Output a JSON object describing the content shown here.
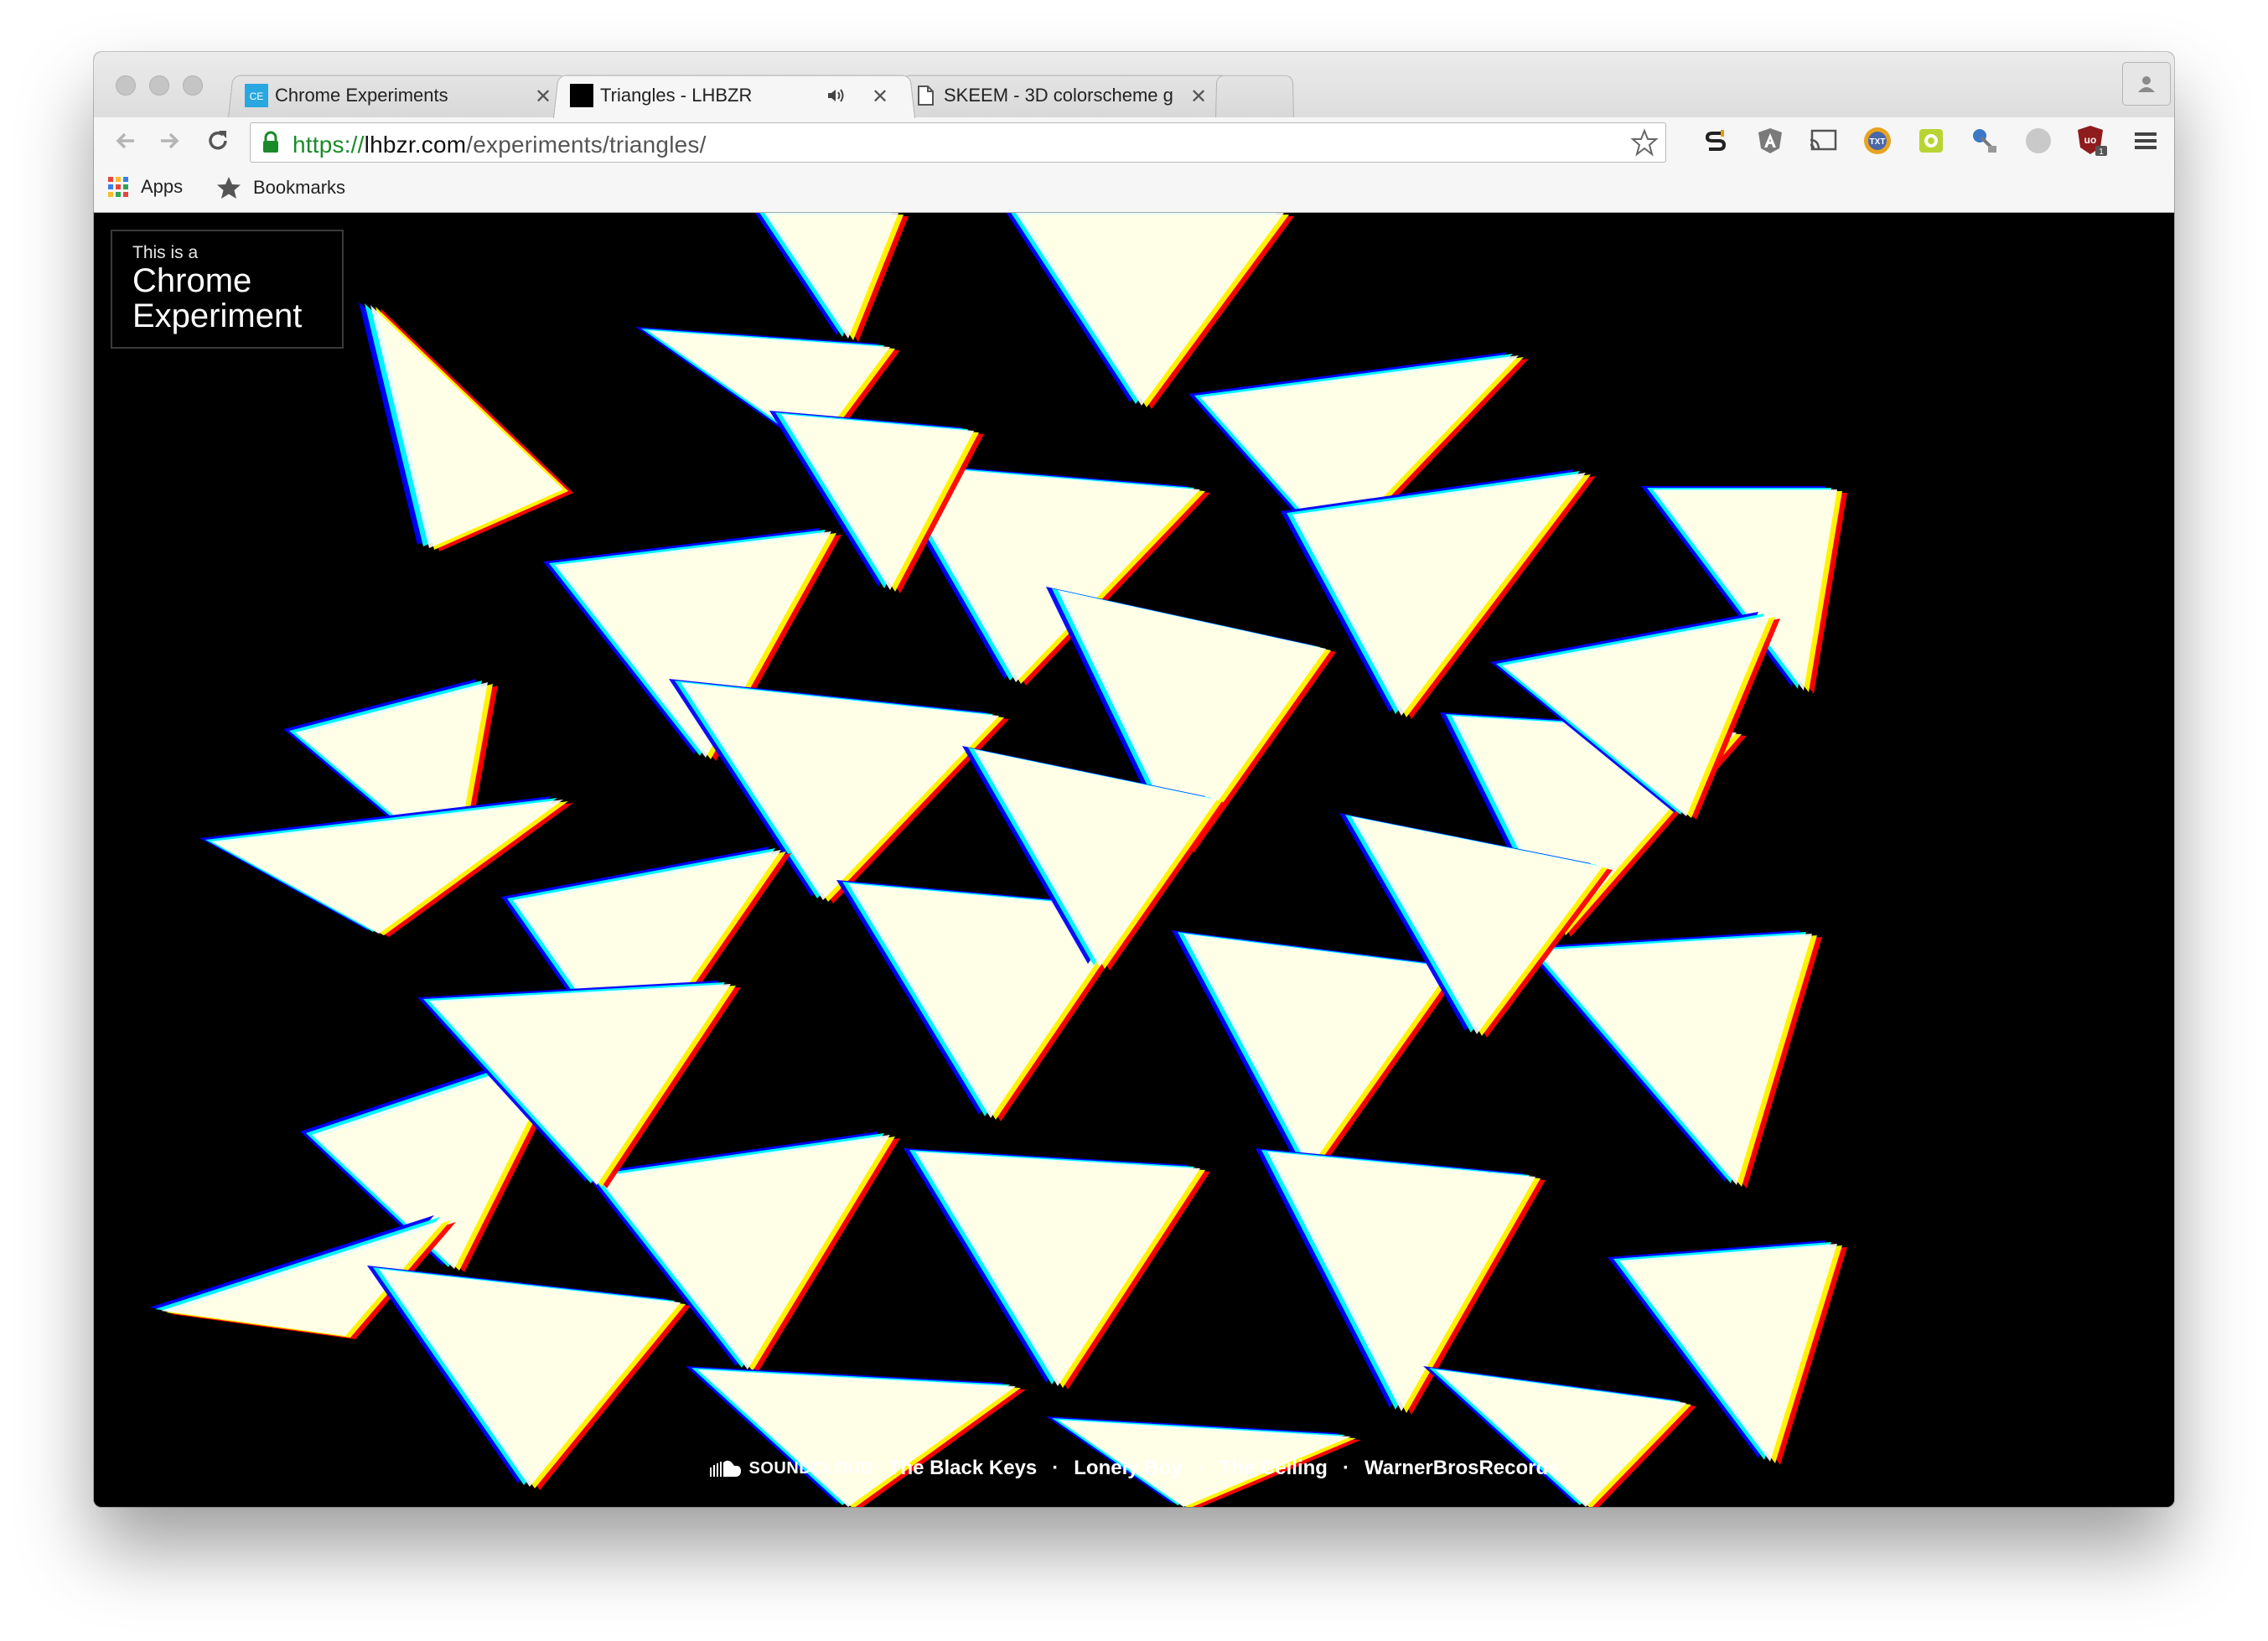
{
  "browser": {
    "tabs": [
      {
        "title": "Chrome Experiments",
        "favicon_text": "CE",
        "active": false
      },
      {
        "title": "Triangles - LHBZR",
        "active": true,
        "audio": true
      },
      {
        "title": "SKEEM - 3D colorscheme g",
        "active": false
      }
    ],
    "url": {
      "scheme": "https://",
      "host": "lhbzr.com",
      "path": "/experiments/triangles/"
    },
    "bookmarks": [
      {
        "label": "Apps",
        "icon": "apps-grid-icon"
      },
      {
        "label": "Bookmarks",
        "icon": "star-icon"
      }
    ],
    "extensions": [
      "extension-s-icon",
      "angular-icon",
      "cast-icon",
      "txt-icon",
      "screenshot-icon",
      "satellite-icon",
      "gray-circle-icon",
      "ublock-icon"
    ],
    "colors": {
      "titlebar": "#dcdcdc",
      "toolbar": "#f6f6f6",
      "secure_green": "#1a8a2a"
    }
  },
  "page": {
    "badge": {
      "small": "This is a",
      "line1": "Chrome",
      "line2": "Experiment"
    },
    "soundcloud": {
      "logo_text": "SOUNDCLOUD",
      "track_parts": [
        "The Black Keys",
        "Lonely Boy",
        "The Ceiling",
        "WarnerBrosRecords"
      ]
    },
    "colors": {
      "background": "#000000",
      "glitch": [
        "#ff0000",
        "#00ffff",
        "#0000ff",
        "#ffff00",
        "#ffffff"
      ]
    }
  }
}
